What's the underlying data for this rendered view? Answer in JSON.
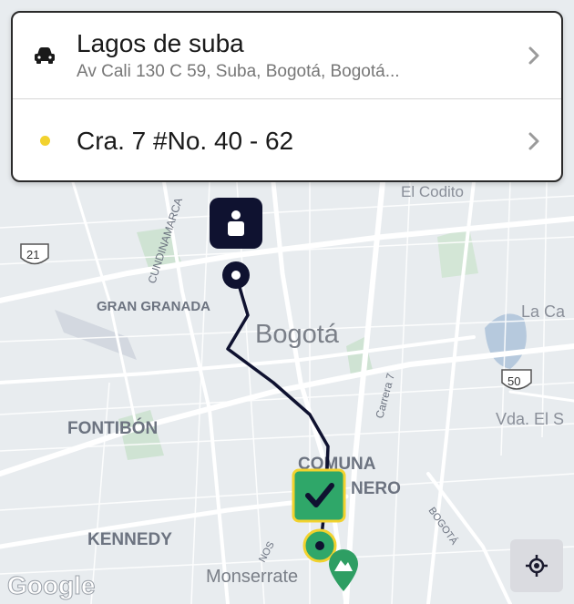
{
  "origin": {
    "title": "Lagos de suba",
    "address": "Av Cali 130 C 59, Suba, Bogotá, Bogotá..."
  },
  "destination": {
    "title": "Cra. 7 #No. 40 - 62"
  },
  "map": {
    "labels": {
      "el_codito": "El Codito",
      "cundinamarca": "CUNDINAMARCA",
      "gran_granada": "GRAN GRANADA",
      "bogota": "Bogotá",
      "la_ca": "La Ca",
      "fontibon": "FONTIBÓN",
      "carrera7": "Carrera 7",
      "vda_el_s": "Vda. El S",
      "comuna": "COMUNA",
      "nero": "NERO",
      "kennedy": "KENNEDY",
      "bogota_road": "BOGOTÁ",
      "nos": "NOS",
      "monserrate": "Monserrate",
      "google": "Google",
      "road21": "21",
      "road50": "50"
    }
  },
  "colors": {
    "route": "#0f1230",
    "accent_yellow": "#f2d22e",
    "pin_green": "#2e9e63",
    "marker_green": "#2fa769"
  }
}
